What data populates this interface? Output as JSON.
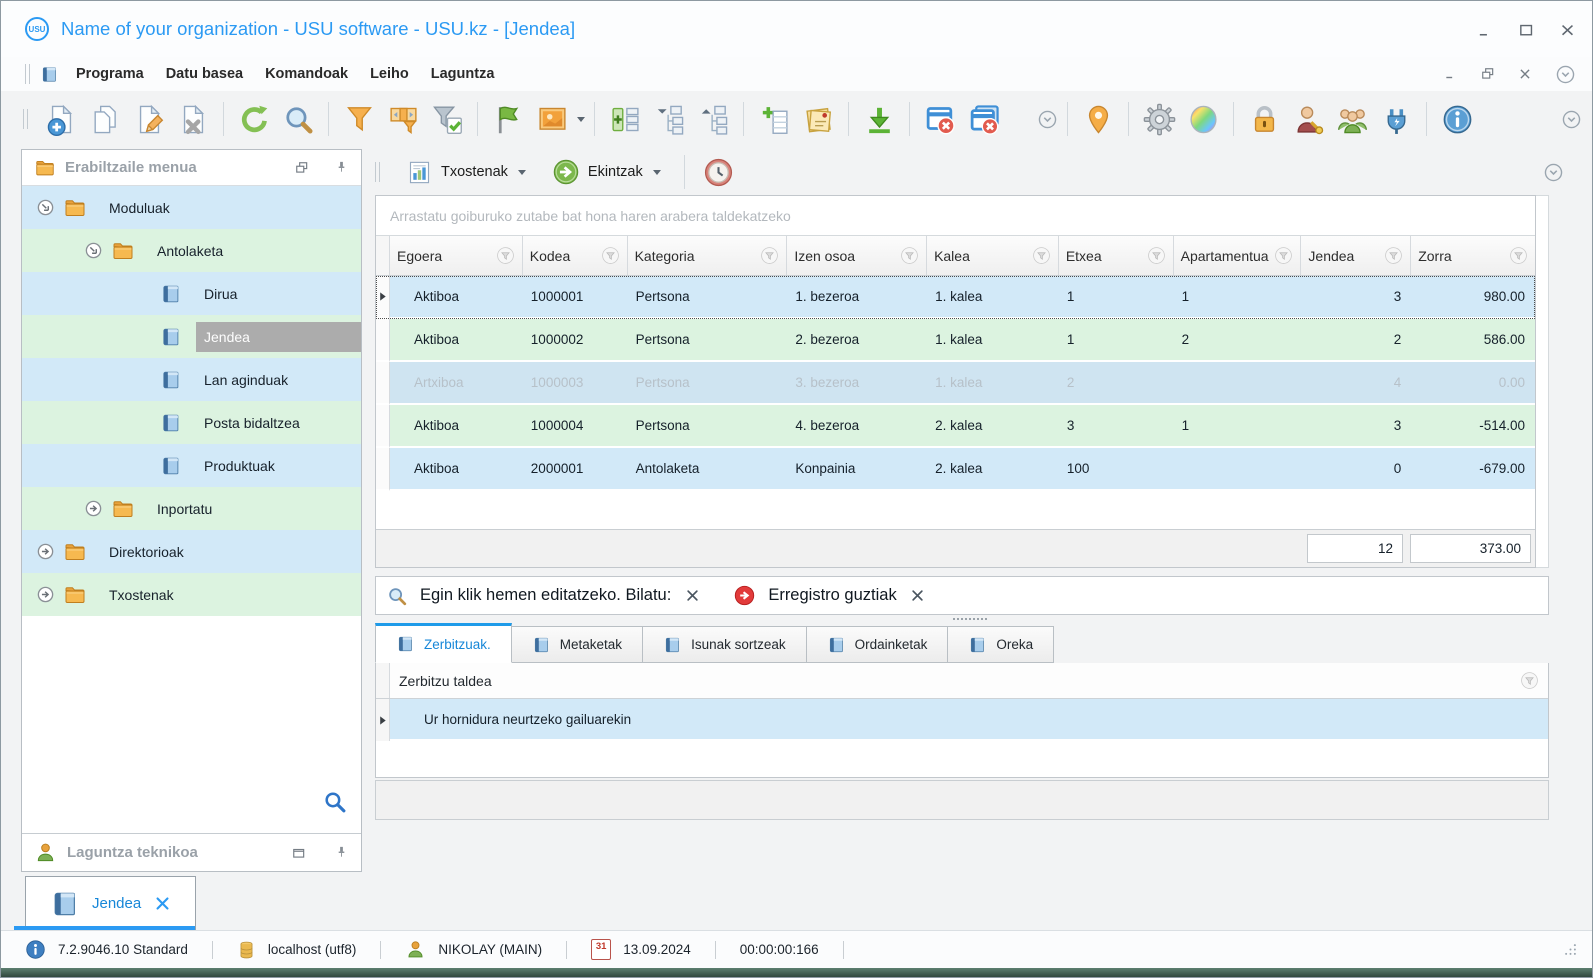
{
  "window": {
    "title": "Name of your organization - USU software - USU.kz - [Jendea]",
    "logo_text": "USU"
  },
  "menu": {
    "items": [
      {
        "label": "Programa"
      },
      {
        "label": "Datu basea"
      },
      {
        "label": "Komandoak"
      },
      {
        "label": "Leiho"
      },
      {
        "label": "Laguntza"
      }
    ]
  },
  "toolbar": {
    "icons": [
      "new-document",
      "copy-document",
      "edit-document",
      "delete-document",
      "refresh",
      "search",
      "filter-funnel",
      "filter-columns",
      "filter-apply",
      "flag",
      "image-view",
      "group-rows",
      "collapse-tree",
      "expand-tree",
      "add-column",
      "notes",
      "export-download",
      "close-window",
      "close-all-windows",
      "overflow-chevron",
      "location-pin",
      "settings-gear",
      "color-palette",
      "lock",
      "user-key",
      "user-group",
      "plugin",
      "info"
    ]
  },
  "panel_toolbar": {
    "reports_label": "Txostenak",
    "actions_label": "Ekintzak"
  },
  "group_by_hint": "Arrastatu goiburuko zutabe bat hona haren arabera taldekatzeko",
  "grid": {
    "columns": [
      "Egoera",
      "Kodea",
      "Kategoria",
      "Izen osoa",
      "Kalea",
      "Etxea",
      "Apartamentua",
      "Jendea",
      "Zorra"
    ],
    "rows": [
      {
        "cells": [
          "Aktiboa",
          "1000001",
          "Pertsona",
          "1. bezeroa",
          "1. kalea",
          "1",
          "1",
          "3",
          "980.00"
        ]
      },
      {
        "cells": [
          "Aktiboa",
          "1000002",
          "Pertsona",
          "2. bezeroa",
          "1. kalea",
          "1",
          "2",
          "2",
          "586.00"
        ]
      },
      {
        "cells": [
          "Artxiboa",
          "1000003",
          "Pertsona",
          "3. bezeroa",
          "1. kalea",
          "2",
          "",
          "4",
          "0.00"
        ]
      },
      {
        "cells": [
          "Aktiboa",
          "1000004",
          "Pertsona",
          "4. bezeroa",
          "2. kalea",
          "3",
          "1",
          "3",
          "-514.00"
        ]
      },
      {
        "cells": [
          "Aktiboa",
          "2000001",
          "Antolaketa",
          "Konpainia",
          "2. kalea",
          "100",
          "",
          "0",
          "-679.00"
        ]
      }
    ],
    "summary": {
      "jendea_total": "12",
      "zorra_total": "373.00"
    }
  },
  "filter_bar": {
    "edit_hint": "Egin klik hemen editatzeko. Bilatu:",
    "scope": "Erregistro guztiak"
  },
  "detail_tabs": [
    {
      "label": "Zerbitzuak."
    },
    {
      "label": "Metaketak"
    },
    {
      "label": "Isunak sortzeak"
    },
    {
      "label": "Ordainketak"
    },
    {
      "label": "Oreka"
    }
  ],
  "detail_grid": {
    "column": "Zerbitzu taldea",
    "rows": [
      {
        "label": "Ur hornidura neurtzeko gailuarekin"
      }
    ]
  },
  "sidebar": {
    "header": "Erabiltzaile menua",
    "tree": [
      {
        "label": "Moduluak"
      },
      {
        "label": "Antolaketa"
      },
      {
        "label": "Dirua"
      },
      {
        "label": "Jendea"
      },
      {
        "label": "Lan aginduak"
      },
      {
        "label": "Posta bidaltzea"
      },
      {
        "label": "Produktuak"
      },
      {
        "label": "Inportatu"
      },
      {
        "label": "Direktorioak"
      },
      {
        "label": "Txostenak"
      }
    ],
    "support_panel": "Laguntza teknikoa"
  },
  "bottom_tab": {
    "label": "Jendea"
  },
  "status_bar": {
    "version": "7.2.9046.10 Standard",
    "database": "localhost (utf8)",
    "user": "NIKOLAY (MAIN)",
    "calendar_day": "31",
    "date": "13.09.2024",
    "time": "00:00:00:166"
  },
  "colors": {
    "accent": "#2b9af3",
    "row_blue": "#d2e9f8",
    "row_green": "#dcf3e0",
    "selected_gray": "#acacac",
    "archived_text": "#b7c1c9"
  }
}
